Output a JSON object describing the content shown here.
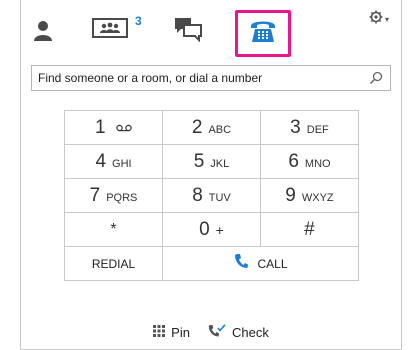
{
  "tabs": {
    "contacts_icon": "person-icon",
    "conversations_icon": "conversations-icon",
    "conversations_badge": "3",
    "chat_icon": "chat-bubbles-icon",
    "phone_icon": "dialpad-phone-icon",
    "options_icon": "gear-icon",
    "options_caret": "▾"
  },
  "colors": {
    "accent": "#1e7fd0",
    "highlight": "#e8158f",
    "border": "#c9c9c9"
  },
  "search": {
    "placeholder": "Find someone or a room, or dial a number",
    "value": ""
  },
  "dialpad": {
    "keys": [
      {
        "num": "1",
        "sub": ""
      },
      {
        "num": "2",
        "sub": "ABC"
      },
      {
        "num": "3",
        "sub": "DEF"
      },
      {
        "num": "4",
        "sub": "GHI"
      },
      {
        "num": "5",
        "sub": "JKL"
      },
      {
        "num": "6",
        "sub": "MNO"
      },
      {
        "num": "7",
        "sub": "PQRS"
      },
      {
        "num": "8",
        "sub": "TUV"
      },
      {
        "num": "9",
        "sub": "WXYZ"
      },
      {
        "num": "*",
        "sub": ""
      },
      {
        "num": "0",
        "sub": "+"
      },
      {
        "num": "#",
        "sub": ""
      }
    ],
    "redial_label": "REDIAL",
    "call_label": "CALL"
  },
  "footer": {
    "pin_label": "Pin",
    "check_label": "Check"
  }
}
